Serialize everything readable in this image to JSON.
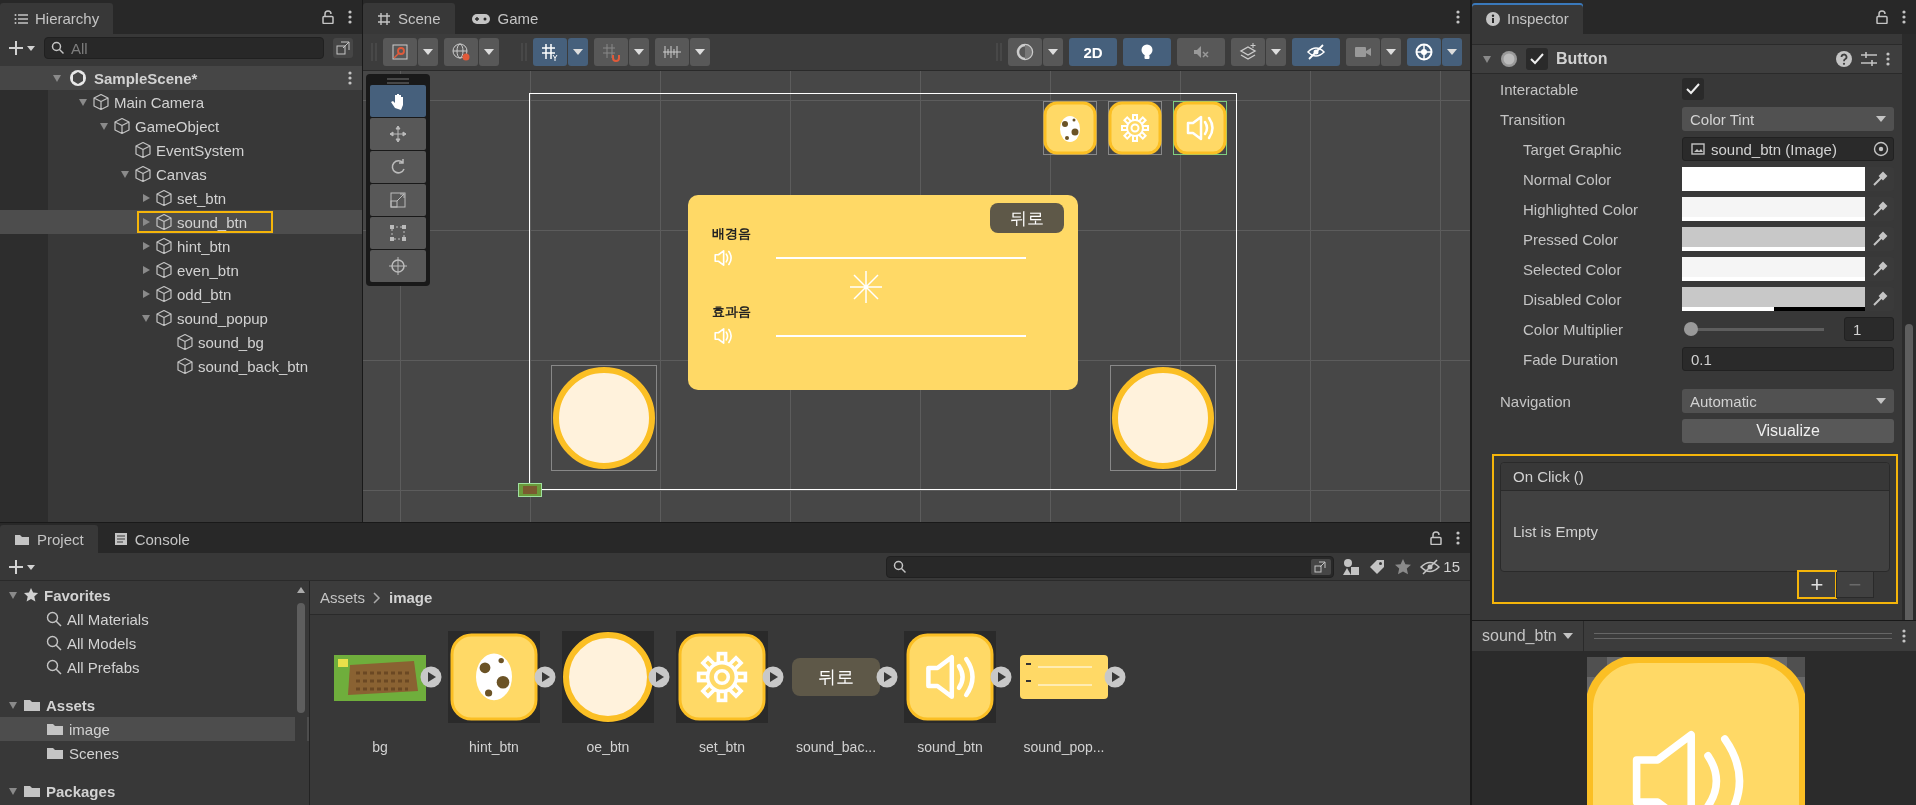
{
  "hierarchy": {
    "tab": "Hierarchy",
    "search_placeholder": "All",
    "scene": {
      "name": "SampleScene*",
      "expanded": true,
      "children": [
        {
          "name": "Main Camera",
          "expanded": true,
          "selected": false,
          "highlighted": false,
          "children": [
            {
              "name": "GameObject",
              "expanded": true,
              "selected": false,
              "highlighted": false,
              "children": [
                {
                  "name": "EventSystem",
                  "selected": false,
                  "highlighted": false
                },
                {
                  "name": "Canvas",
                  "expanded": true,
                  "selected": false,
                  "highlighted": false,
                  "children": [
                    {
                      "name": "set_btn",
                      "expanded": false,
                      "selected": false,
                      "highlighted": false
                    },
                    {
                      "name": "sound_btn",
                      "expanded": false,
                      "selected": true,
                      "highlighted": true
                    },
                    {
                      "name": "hint_btn",
                      "expanded": false,
                      "selected": false,
                      "highlighted": false
                    },
                    {
                      "name": "even_btn",
                      "expanded": false,
                      "selected": false,
                      "highlighted": false
                    },
                    {
                      "name": "odd_btn",
                      "expanded": false,
                      "selected": false,
                      "highlighted": false
                    },
                    {
                      "name": "sound_popup",
                      "expanded": true,
                      "selected": false,
                      "highlighted": false,
                      "children": [
                        {
                          "name": "sound_bg",
                          "selected": false,
                          "highlighted": false
                        },
                        {
                          "name": "sound_back_btn",
                          "selected": false,
                          "highlighted": false
                        }
                      ]
                    }
                  ]
                }
              ]
            }
          ]
        }
      ]
    }
  },
  "scene": {
    "tabs": [
      {
        "label": "Scene",
        "kind": "grid",
        "selected": true
      },
      {
        "label": "Game",
        "kind": "gamepad",
        "selected": false
      }
    ],
    "toolbar_left": [
      {
        "kind": "rect-gizmo",
        "on": false,
        "dropdown": true
      },
      {
        "kind": "globe",
        "on": false,
        "dropdown": true
      },
      {
        "kind": "grid-snap",
        "on": true,
        "dropdown": true
      },
      {
        "kind": "snap",
        "on": false,
        "dropdown": true
      },
      {
        "kind": "ruler",
        "on": false,
        "dropdown": true
      }
    ],
    "toolbar_right": [
      {
        "kind": "shading",
        "on": false,
        "dropdown": true
      },
      {
        "kind": "mode",
        "label": "2D",
        "on": true,
        "dropdown": false
      },
      {
        "kind": "light",
        "on": true,
        "dropdown": false
      },
      {
        "kind": "audio",
        "on": false,
        "dropdown": false
      },
      {
        "kind": "effects",
        "on": false,
        "dropdown": true
      },
      {
        "kind": "hidden",
        "on": true,
        "dropdown": false
      },
      {
        "kind": "camera",
        "on": false,
        "dropdown": true
      },
      {
        "kind": "gizmos",
        "on": true,
        "dropdown": true
      }
    ],
    "tools": [
      {
        "kind": "hand",
        "selected": true
      },
      {
        "kind": "move",
        "selected": false
      },
      {
        "kind": "rotate",
        "selected": false
      },
      {
        "kind": "scale",
        "selected": false
      },
      {
        "kind": "rect",
        "selected": false
      },
      {
        "kind": "transform",
        "selected": false
      }
    ],
    "popup": {
      "back_label": "뒤로",
      "rows": [
        {
          "label": "배경음"
        },
        {
          "label": "효과음"
        }
      ]
    }
  },
  "inspector": {
    "tab": "Inspector",
    "component": {
      "name": "Button",
      "enabled": true,
      "expanded": true
    },
    "properties": [
      {
        "kind": "checkbox",
        "label": "Interactable",
        "checked": true
      },
      {
        "kind": "dropdown",
        "label": "Transition",
        "value": "Color Tint",
        "children": [
          {
            "kind": "object",
            "label": "Target Graphic",
            "value": "sound_btn (Image)"
          },
          {
            "kind": "color",
            "label": "Normal Color",
            "color": "#ffffff",
            "level": 1
          },
          {
            "kind": "color",
            "label": "Highlighted Color",
            "color": "#f5f5f5",
            "level": 1
          },
          {
            "kind": "color",
            "label": "Pressed Color",
            "color": "#c8c8c8",
            "level": 1
          },
          {
            "kind": "color",
            "label": "Selected Color",
            "color": "#f5f5f5",
            "level": 1
          },
          {
            "kind": "color",
            "label": "Disabled Color",
            "color": "#c8c8c8",
            "level": 0.5
          },
          {
            "kind": "slider",
            "label": "Color Multiplier",
            "level": 0,
            "value": "1"
          },
          {
            "kind": "number",
            "label": "Fade Duration",
            "value": "0.1"
          }
        ]
      },
      {
        "kind": "dropdown",
        "label": "Navigation",
        "value": "Automatic"
      },
      {
        "kind": "button",
        "label": "Visualize"
      }
    ],
    "event": {
      "title": "On Click ()",
      "empty_text": "List is Empty",
      "highlighted": true,
      "buttons": [
        {
          "label": "+",
          "disabled": false,
          "highlighted": true
        },
        {
          "label": "−",
          "disabled": true,
          "highlighted": false
        }
      ]
    }
  },
  "preview": {
    "title": "sound_btn"
  },
  "project": {
    "tabs": [
      {
        "label": "Project",
        "kind": "folder",
        "selected": true
      },
      {
        "label": "Console",
        "kind": "console",
        "selected": false
      }
    ],
    "hidden_count": "15",
    "tree": [
      {
        "label": "Favorites",
        "kind": "star",
        "expanded": true,
        "selected": false,
        "children": [
          {
            "label": "All Materials",
            "kind": "search",
            "selected": false
          },
          {
            "label": "All Models",
            "kind": "search",
            "selected": false
          },
          {
            "label": "All Prefabs",
            "kind": "search",
            "selected": false
          }
        ]
      },
      {
        "label": "Assets",
        "kind": "folder",
        "expanded": true,
        "selected": false,
        "children": [
          {
            "label": "image",
            "kind": "folder",
            "selected": true
          },
          {
            "label": "Scenes",
            "kind": "folder",
            "selected": false
          }
        ]
      },
      {
        "label": "Packages",
        "kind": "folder",
        "expanded": true,
        "selected": false
      }
    ],
    "breadcrumb": [
      "Assets",
      "image"
    ],
    "assets": [
      {
        "label": "bg",
        "kind": "field"
      },
      {
        "label": "hint_btn",
        "kind": "egg"
      },
      {
        "label": "oe_btn",
        "kind": "circle"
      },
      {
        "label": "set_btn",
        "kind": "gear"
      },
      {
        "label": "sound_bac...",
        "kind": "back",
        "text": "뒤로"
      },
      {
        "label": "sound_btn",
        "kind": "speaker"
      },
      {
        "label": "sound_pop...",
        "kind": "popup"
      }
    ]
  }
}
